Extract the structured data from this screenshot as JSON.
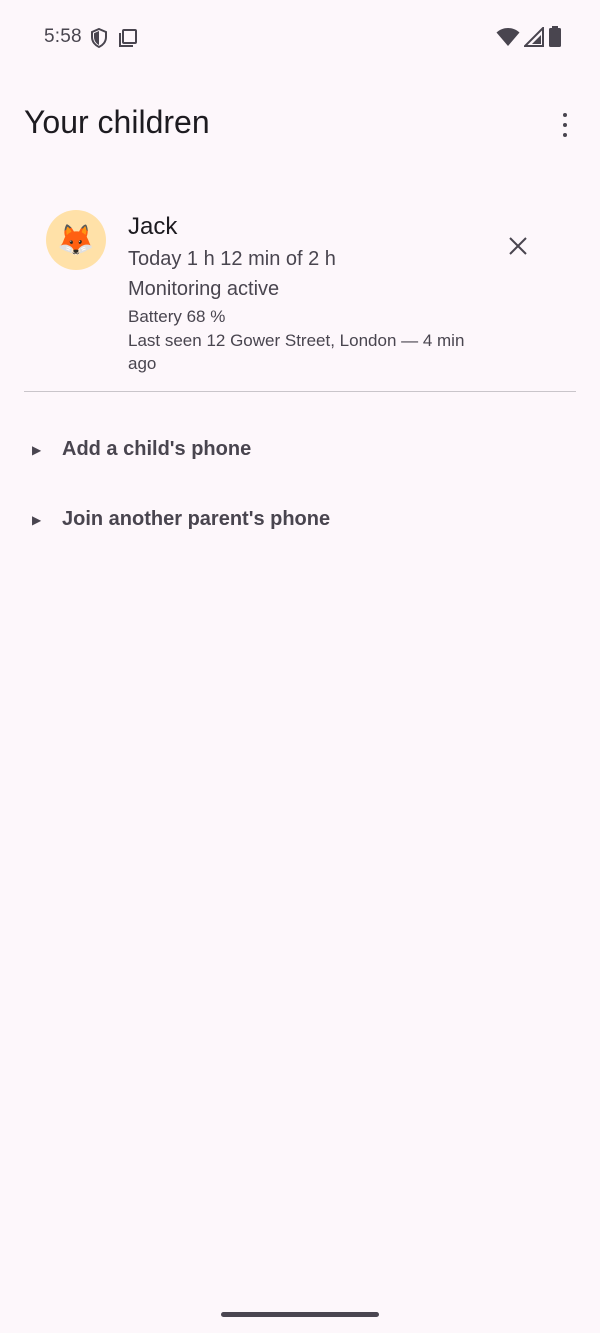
{
  "status_bar": {
    "time": "5:58",
    "left_icons": [
      "shield-icon",
      "clipboard-icon"
    ],
    "right_icons": [
      "wifi-icon",
      "cellular-signal-icon",
      "battery-icon"
    ]
  },
  "header": {
    "title": "Your children",
    "menu_icon": "more-vert-icon"
  },
  "child": {
    "avatar_icon": "fox-icon",
    "avatar_glyph": "🦊",
    "name": "Jack",
    "usage": "Today 1 h 12 min of 2 h",
    "monitoring": "Monitoring active",
    "battery": "Battery 68 %",
    "location": "Last seen 12 Gower Street, London — 4 min ago",
    "remove_icon": "close-icon"
  },
  "actions": [
    {
      "label": "Add a child's phone",
      "glyph": "▶"
    },
    {
      "label": "Join another parent's phone",
      "glyph": "▶"
    }
  ],
  "colors": {
    "background": "#fdf7fb",
    "text_primary": "#1d1b20",
    "text_secondary": "#49454f",
    "divider": "#c9c5ca",
    "avatar_bg": "#ffe1a8"
  }
}
